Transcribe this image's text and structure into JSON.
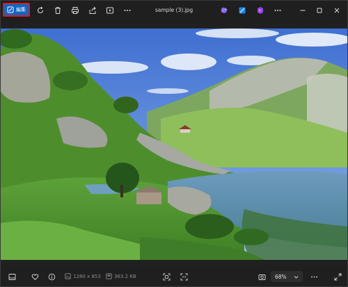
{
  "toolbar": {
    "edit_label": "編集",
    "file_name": "sample (3).jpg"
  },
  "image": {
    "description_icons": [
      "mountain-photo"
    ]
  },
  "statusbar": {
    "dimensions": "1280 x 853",
    "file_size": "363.2 KB",
    "zoom_level": "68%"
  },
  "colors": {
    "accent": "#1565c0",
    "highlight_border": "#e01a1a",
    "background": "#202020"
  }
}
